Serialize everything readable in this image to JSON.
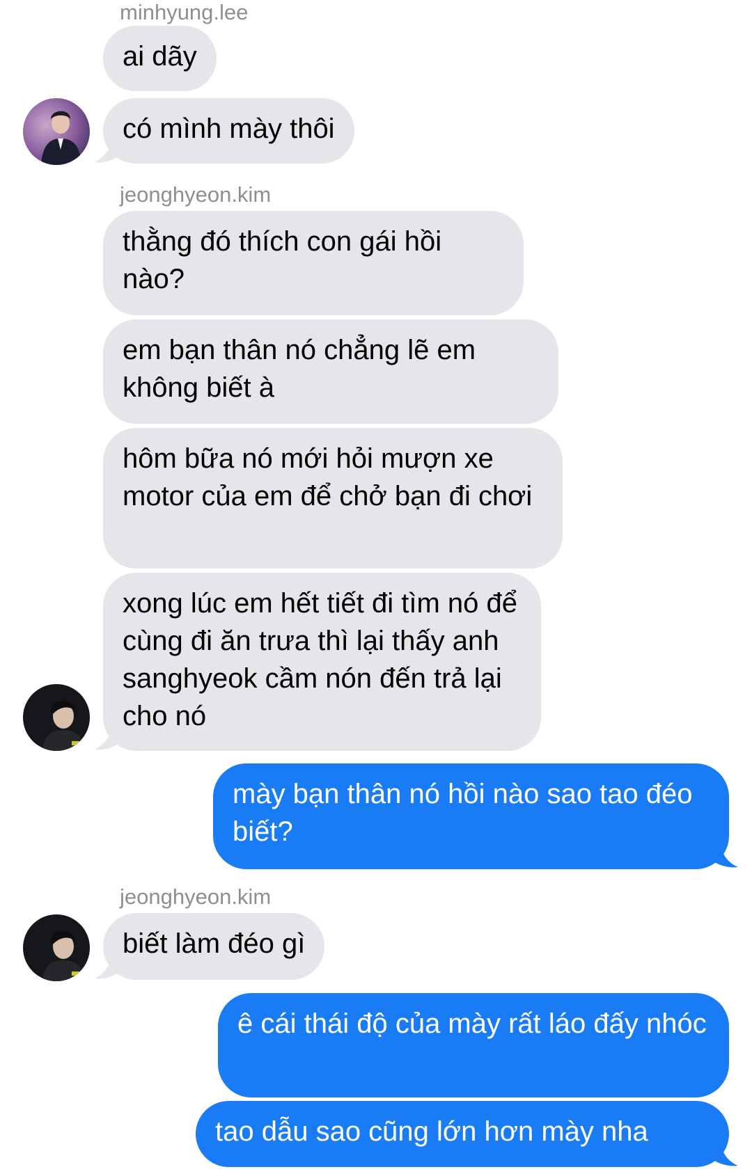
{
  "conversation": {
    "groups": [
      {
        "sender": "minhyung.lee",
        "messages": [
          "ai dãy",
          "có mình mày thôi"
        ]
      },
      {
        "sender": "jeonghyeon.kim",
        "messages": [
          "thằng đó thích con gái hồi nào?",
          "em bạn thân nó chẳng lẽ em không biết à",
          "hôm bữa nó mới hỏi mượn xe motor của em để chở bạn đi chơi",
          "xong lúc em hết tiết đi tìm nó để cùng đi ăn trưa thì lại thấy anh sanghyeok cầm nón đến trả lại cho nó"
        ]
      },
      {
        "sender": "me",
        "messages": [
          "mày bạn thân nó hồi nào sao tao đéo biết?"
        ]
      },
      {
        "sender": "jeonghyeon.kim",
        "messages": [
          "biết làm đéo gì"
        ]
      },
      {
        "sender": "me",
        "messages": [
          "ê cái thái độ của mày rất láo đấy nhóc",
          "tao dẫu sao cũng lớn hơn mày nha"
        ]
      }
    ]
  },
  "colors": {
    "incoming_bubble": "#e5e5ea",
    "outgoing_bubble": "#1a7cf5",
    "sender_label": "#8e8e93"
  },
  "icons": {
    "avatar_1": "profile-photo-minhyung",
    "avatar_2": "profile-photo-jeonghyeon"
  }
}
